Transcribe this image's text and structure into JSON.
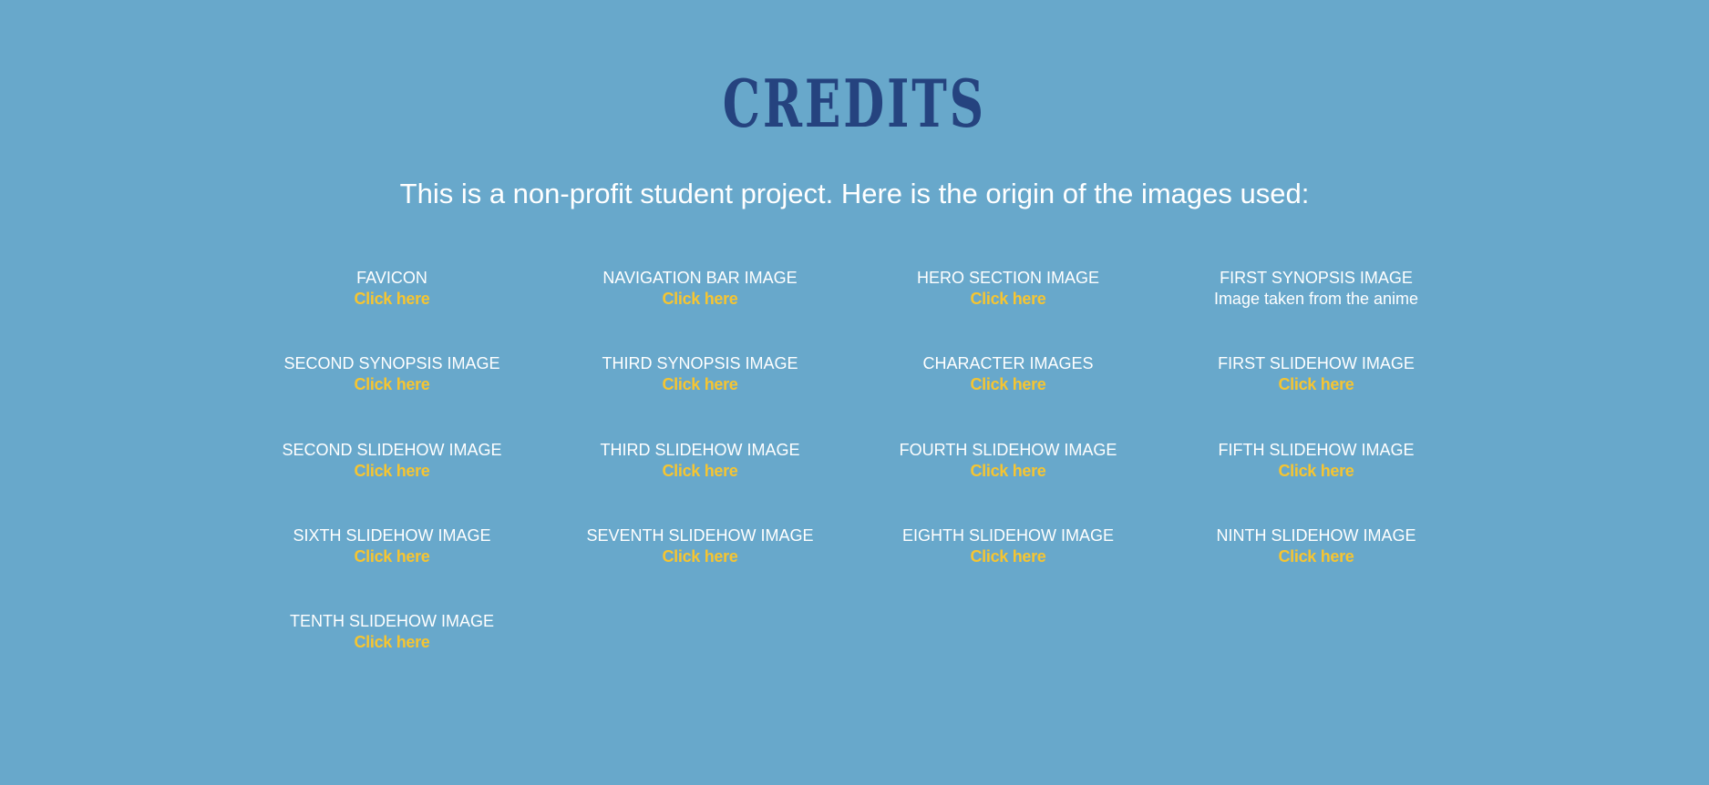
{
  "header": {
    "logo_text": "CREDITS"
  },
  "intro": {
    "text": "This is a non-profit student project. Here is the origin of the images used:"
  },
  "credits": [
    {
      "title": "FAVICON",
      "link": "Click here"
    },
    {
      "title": "NAVIGATION BAR IMAGE",
      "link": "Click here"
    },
    {
      "title": "HERO SECTION IMAGE",
      "link": "Click here"
    },
    {
      "title": "FIRST SYNOPSIS IMAGE",
      "note": "Image taken from the anime"
    },
    {
      "title": "SECOND SYNOPSIS IMAGE",
      "link": "Click here"
    },
    {
      "title": "THIRD SYNOPSIS IMAGE",
      "link": "Click here"
    },
    {
      "title": "CHARACTER IMAGES",
      "link": "Click here"
    },
    {
      "title": "FIRST SLIDEHOW IMAGE",
      "link": "Click here"
    },
    {
      "title": "SECOND SLIDEHOW IMAGE",
      "link": "Click here"
    },
    {
      "title": "THIRD SLIDEHOW IMAGE",
      "link": "Click here"
    },
    {
      "title": "FOURTH SLIDEHOW IMAGE",
      "link": "Click here"
    },
    {
      "title": "FIFTH SLIDEHOW IMAGE",
      "link": "Click here"
    },
    {
      "title": "SIXTH SLIDEHOW IMAGE",
      "link": "Click here"
    },
    {
      "title": "SEVENTH SLIDEHOW IMAGE",
      "link": "Click here"
    },
    {
      "title": "EIGHTH SLIDEHOW IMAGE",
      "link": "Click here"
    },
    {
      "title": "NINTH SLIDEHOW IMAGE",
      "link": "Click here"
    },
    {
      "title": "TENTH SLIDEHOW IMAGE",
      "link": "Click here"
    }
  ],
  "colors": {
    "background": "#68a8cb",
    "logo": "#25437f",
    "link": "#f6c531",
    "text": "#ffffff"
  }
}
